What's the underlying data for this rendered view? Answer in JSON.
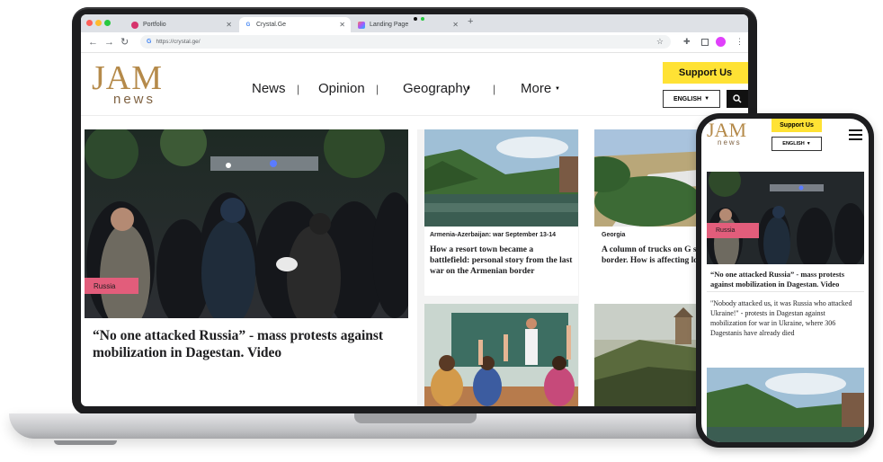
{
  "browser": {
    "tabs": [
      {
        "label": "Portfolio",
        "active": false
      },
      {
        "label": "Crystal.Ge",
        "active": true
      },
      {
        "label": "Landing Page",
        "active": false
      }
    ],
    "new_tab": "+",
    "url": "https://crystal.ge/"
  },
  "site": {
    "logo_top": "JAM",
    "logo_bottom": "news",
    "nav": [
      "News",
      "Opinion",
      "Geography",
      "More"
    ],
    "support": "Support Us",
    "language": "ENGLISH"
  },
  "lead": {
    "tag": "Russia",
    "title": "“No one attacked Russia” - mass protests against mobilization in Dagestan. Video"
  },
  "cards": [
    {
      "category": "Armenia-Azerbaijan: war September 13-14",
      "title": "How a resort town became a battlefield: personal story from the last war on the Armenian border"
    },
    {
      "category": "Georgia",
      "title": "A column of trucks on G southern border. How is affecting locals?"
    }
  ],
  "phone": {
    "support": "Support Us",
    "language": "ENGLISH",
    "logo_top": "JAM",
    "logo_bottom": "news",
    "tag": "Russia",
    "title": "“No one attacked Russia” - mass protests against mobilization in Dagestan. Video",
    "summary": "\"Nobody attacked us, it was Russia who attacked Ukraine!\" - protests in Dagestan against mobilization for war in Ukraine, where 306 Dagestanis have already died"
  },
  "colors": {
    "brand_gold": "#b58a4a",
    "support_yellow": "#ffe234",
    "tag_pink": "#e25d7b",
    "bezel": "#1d1d1f"
  }
}
